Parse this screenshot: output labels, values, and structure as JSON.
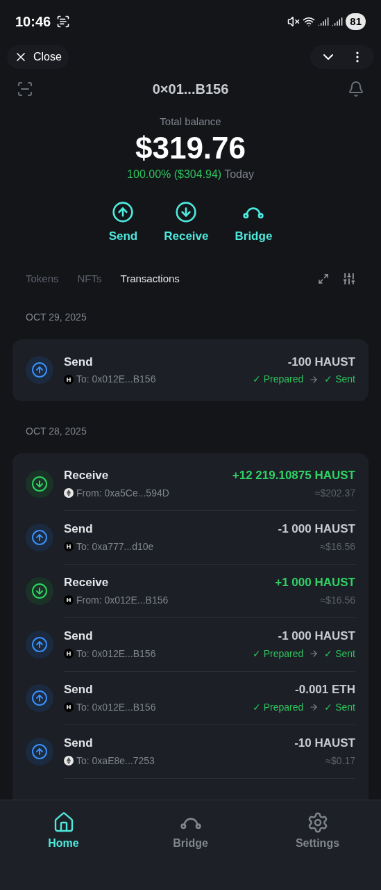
{
  "status_bar": {
    "time": "10:46",
    "battery": "81"
  },
  "top_bar": {
    "close_label": "Close"
  },
  "header": {
    "title": "0×01...B156"
  },
  "balance": {
    "label": "Total balance",
    "amount": "$319.76",
    "change": "100.00% ($304.94)",
    "period": "Today"
  },
  "actions": [
    {
      "kind": "send",
      "label": "Send"
    },
    {
      "kind": "receive",
      "label": "Receive"
    },
    {
      "kind": "bridge",
      "label": "Bridge"
    }
  ],
  "tabs": [
    {
      "label": "Tokens",
      "selected": false
    },
    {
      "label": "NFTs",
      "selected": false
    },
    {
      "label": "Transactions",
      "selected": true
    }
  ],
  "groups": [
    {
      "date": "OCT 29, 2025",
      "transactions": [
        {
          "kind": "send",
          "title": "Send",
          "token": {
            "kind": "haust"
          },
          "address": "To: 0x012E...B156",
          "amount": "-100 HAUST",
          "statuses": [
            "✓ Prepared",
            "✓ Sent"
          ]
        }
      ]
    },
    {
      "date": "OCT 28, 2025",
      "transactions": [
        {
          "kind": "receive",
          "title": "Receive",
          "token": {
            "kind": "eth"
          },
          "address": "From: 0xa5Ce...594D",
          "amount": "+12 219.10875 HAUST",
          "usd": "≈$202.37"
        },
        {
          "kind": "send",
          "title": "Send",
          "token": {
            "kind": "haust"
          },
          "address": "To: 0xa777...d10e",
          "amount": "-1 000 HAUST",
          "usd": "≈$16.56"
        },
        {
          "kind": "receive",
          "title": "Receive",
          "token": {
            "kind": "haust"
          },
          "address": "From: 0x012E...B156",
          "amount": "+1 000 HAUST",
          "usd": "≈$16.56"
        },
        {
          "kind": "send",
          "title": "Send",
          "token": {
            "kind": "haust"
          },
          "address": "To: 0x012E...B156",
          "amount": "-1 000 HAUST",
          "statuses": [
            "✓ Prepared",
            "✓ Sent"
          ]
        },
        {
          "kind": "send",
          "title": "Send",
          "token": {
            "kind": "haust"
          },
          "address": "To: 0x012E...B156",
          "amount": "-0.001 ETH",
          "statuses": [
            "✓ Prepared",
            "✓ Sent"
          ]
        },
        {
          "kind": "send",
          "title": "Send",
          "token": {
            "kind": "eth"
          },
          "address": "To: 0xaE8e...7253",
          "amount": "-10 HAUST",
          "usd": "≈$0.17"
        }
      ]
    }
  ],
  "nav": [
    {
      "kind": "home",
      "label": "Home",
      "selected": true
    },
    {
      "kind": "bridge",
      "label": "Bridge",
      "selected": false
    },
    {
      "kind": "settings",
      "label": "Settings",
      "selected": false
    }
  ]
}
